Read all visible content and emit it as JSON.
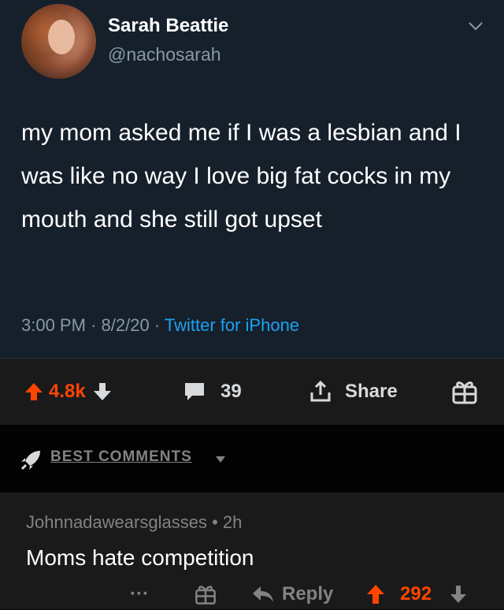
{
  "tweet": {
    "name": "Sarah Beattie",
    "handle": "@nachosarah",
    "text": "my mom asked me if I was a lesbian and I was like no way I love big fat cocks in my mouth and she still got upset",
    "time": "3:00 PM",
    "date": "8/2/20",
    "separator": "·",
    "source": "Twitter for iPhone"
  },
  "post_actions": {
    "upvotes": "4.8k",
    "comments": "39",
    "share_label": "Share"
  },
  "sort": {
    "label": "BEST COMMENTS"
  },
  "comment": {
    "author": "Johnnadawearsglasses",
    "bullet": "•",
    "age": "2h",
    "body": "Moms hate competition",
    "more": "···",
    "reply_label": "Reply",
    "score": "292"
  },
  "colors": {
    "tweet_bg": "#15202b",
    "reddit_orange": "#ff4500",
    "twitter_blue": "#1da1f2",
    "muted": "#818384"
  }
}
